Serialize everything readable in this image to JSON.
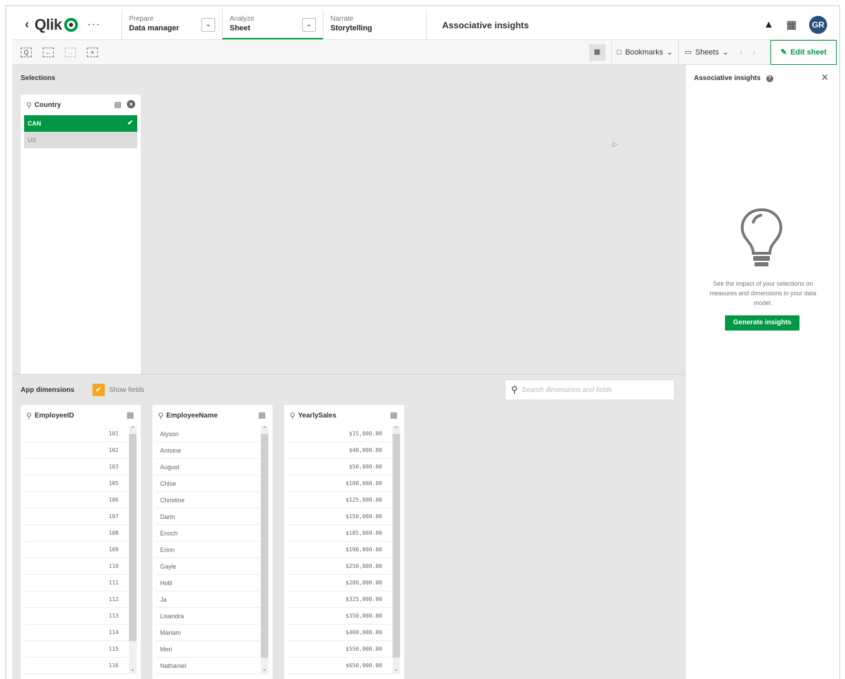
{
  "header": {
    "nav": [
      {
        "small": "Prepare",
        "big": "Data manager"
      },
      {
        "small": "Analyze",
        "big": "Sheet"
      },
      {
        "small": "Narrate",
        "big": "Storytelling"
      }
    ],
    "title": "Associative insights",
    "avatar": "GR"
  },
  "toolbar": {
    "bookmarks": "Bookmarks",
    "sheets": "Sheets",
    "edit": "Edit sheet"
  },
  "selections": {
    "label": "Selections",
    "field": "Country",
    "options": [
      {
        "value": "CAN",
        "state": "selected"
      },
      {
        "value": "US",
        "state": "excluded"
      }
    ]
  },
  "app_dimensions": {
    "label": "App dimensions",
    "show_fields": "Show fields",
    "search_placeholder": "Search dimensions and fields",
    "lists": [
      {
        "field": "EmployeeID",
        "values": [
          "101",
          "102",
          "103",
          "105",
          "106",
          "107",
          "108",
          "109",
          "110",
          "111",
          "112",
          "113",
          "114",
          "115",
          "116"
        ]
      },
      {
        "field": "EmployeeName",
        "values": [
          "Alyson",
          "Antoine",
          "August",
          "Chloe",
          "Christine",
          "Darin",
          "Enoch",
          "Erinn",
          "Gayle",
          "Holli",
          "Ja",
          "Lisandra",
          "Mariam",
          "Meri",
          "Nathaniel"
        ]
      },
      {
        "field": "YearlySales",
        "values": [
          "$15,000.00",
          "$40,000.00",
          "$50,000.00",
          "$100,000.00",
          "$125,000.00",
          "$150,000.00",
          "$185,000.00",
          "$190,000.00",
          "$250,000.00",
          "$280,000.00",
          "$325,000.00",
          "$350,000.00",
          "$400,000.00",
          "$550,000.00",
          "$650,000.00"
        ]
      }
    ]
  },
  "panel": {
    "title": "Associative insights",
    "description": "See the impact of your selections on measures and dimensions in your data model.",
    "button": "Generate insights"
  },
  "colors": {
    "accent": "#009845",
    "checkbox": "#f5a623",
    "avatar": "#254e7a"
  }
}
